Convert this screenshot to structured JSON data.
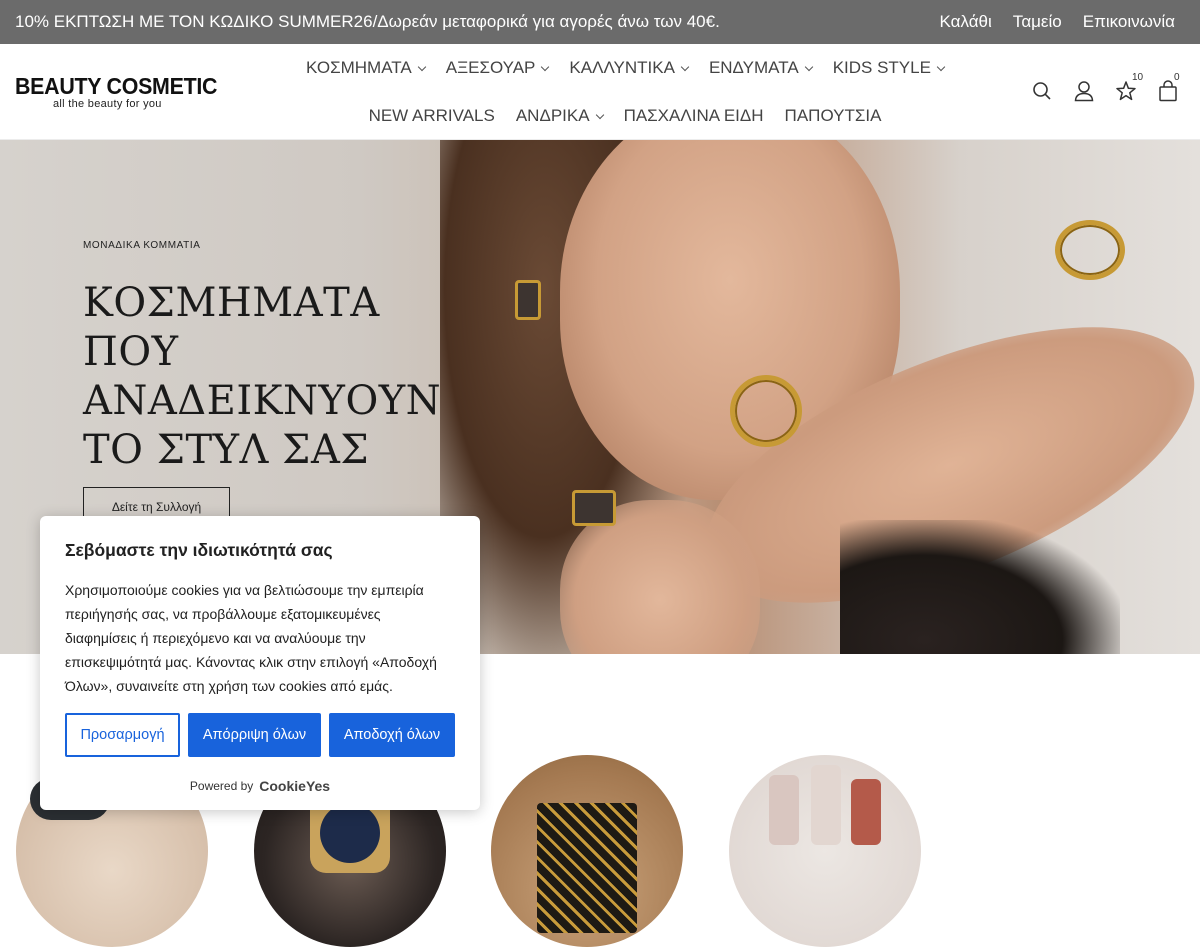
{
  "topbar": {
    "promo": "10% ΕΚΠΤΩΣΗ ΜΕ ΤΟΝ ΚΩΔΙΚΟ SUMMER26/Δωρεάν μεταφορικά για αγορές άνω των 40€.",
    "links": [
      "Καλάθι",
      "Ταμείο",
      "Επικοινωνία"
    ]
  },
  "header": {
    "logo_brand": "BEAUTY COSMETIC",
    "logo_tagline": "all the beauty for you",
    "nav_row1": [
      "ΚΟΣΜΗΜΑΤΑ",
      "ΑΞΕΣΟΥΑΡ",
      "ΚΑΛΛΥΝΤΙΚΑ",
      "ΕΝΔΥΜΑΤΑ",
      "KIDS STYLE"
    ],
    "nav_row2": [
      "NEW ARRIVALS",
      "ΑΝΔΡΙΚΑ",
      "ΠΑΣΧΑΛΙΝΑ ΕΙΔΗ",
      "ΠΑΠΟΥΤΣΙΑ"
    ],
    "wishlist_count": "10",
    "cart_count": "0",
    "icons": [
      "search-icon",
      "user-icon",
      "star-icon",
      "bag-icon"
    ]
  },
  "hero": {
    "eyebrow": "ΜΟΝΑΔΙΚΑ ΚΟΜΜΑΤΙΑ",
    "title_line1": "ΚΟΣΜΗΜΑΤΑ ΠΟΥ",
    "title_line2": "ΑΝΑΔΕΙΚΝΥΟΥΝ",
    "title_line3": "ΤΟ ΣΤΥΛ ΣΑΣ",
    "cta": "Δείτε τη Συλλογή"
  },
  "cookie": {
    "title": "Σεβόμαστε την ιδιωτικότητά σας",
    "body": "Χρησιμοποιούμε cookies για να βελτιώσουμε την εμπειρία περιήγησής σας, να προβάλλουμε εξατομικευμένες διαφημίσεις ή περιεχόμενο και να αναλύουμε την επισκεψιμότητά μας. Κάνοντας κλικ στην επιλογή «Αποδοχή Όλων», συναινείτε στη χρήση των cookies από εμάς.",
    "customize": "Προσαρμογή",
    "reject": "Απόρριψη όλων",
    "accept": "Αποδοχή όλων",
    "powered_by": "Powered by",
    "powered_brand": "CookieYes"
  },
  "colors": {
    "topbar_bg": "#6b6b6b",
    "cookie_accent": "#1863dc"
  }
}
